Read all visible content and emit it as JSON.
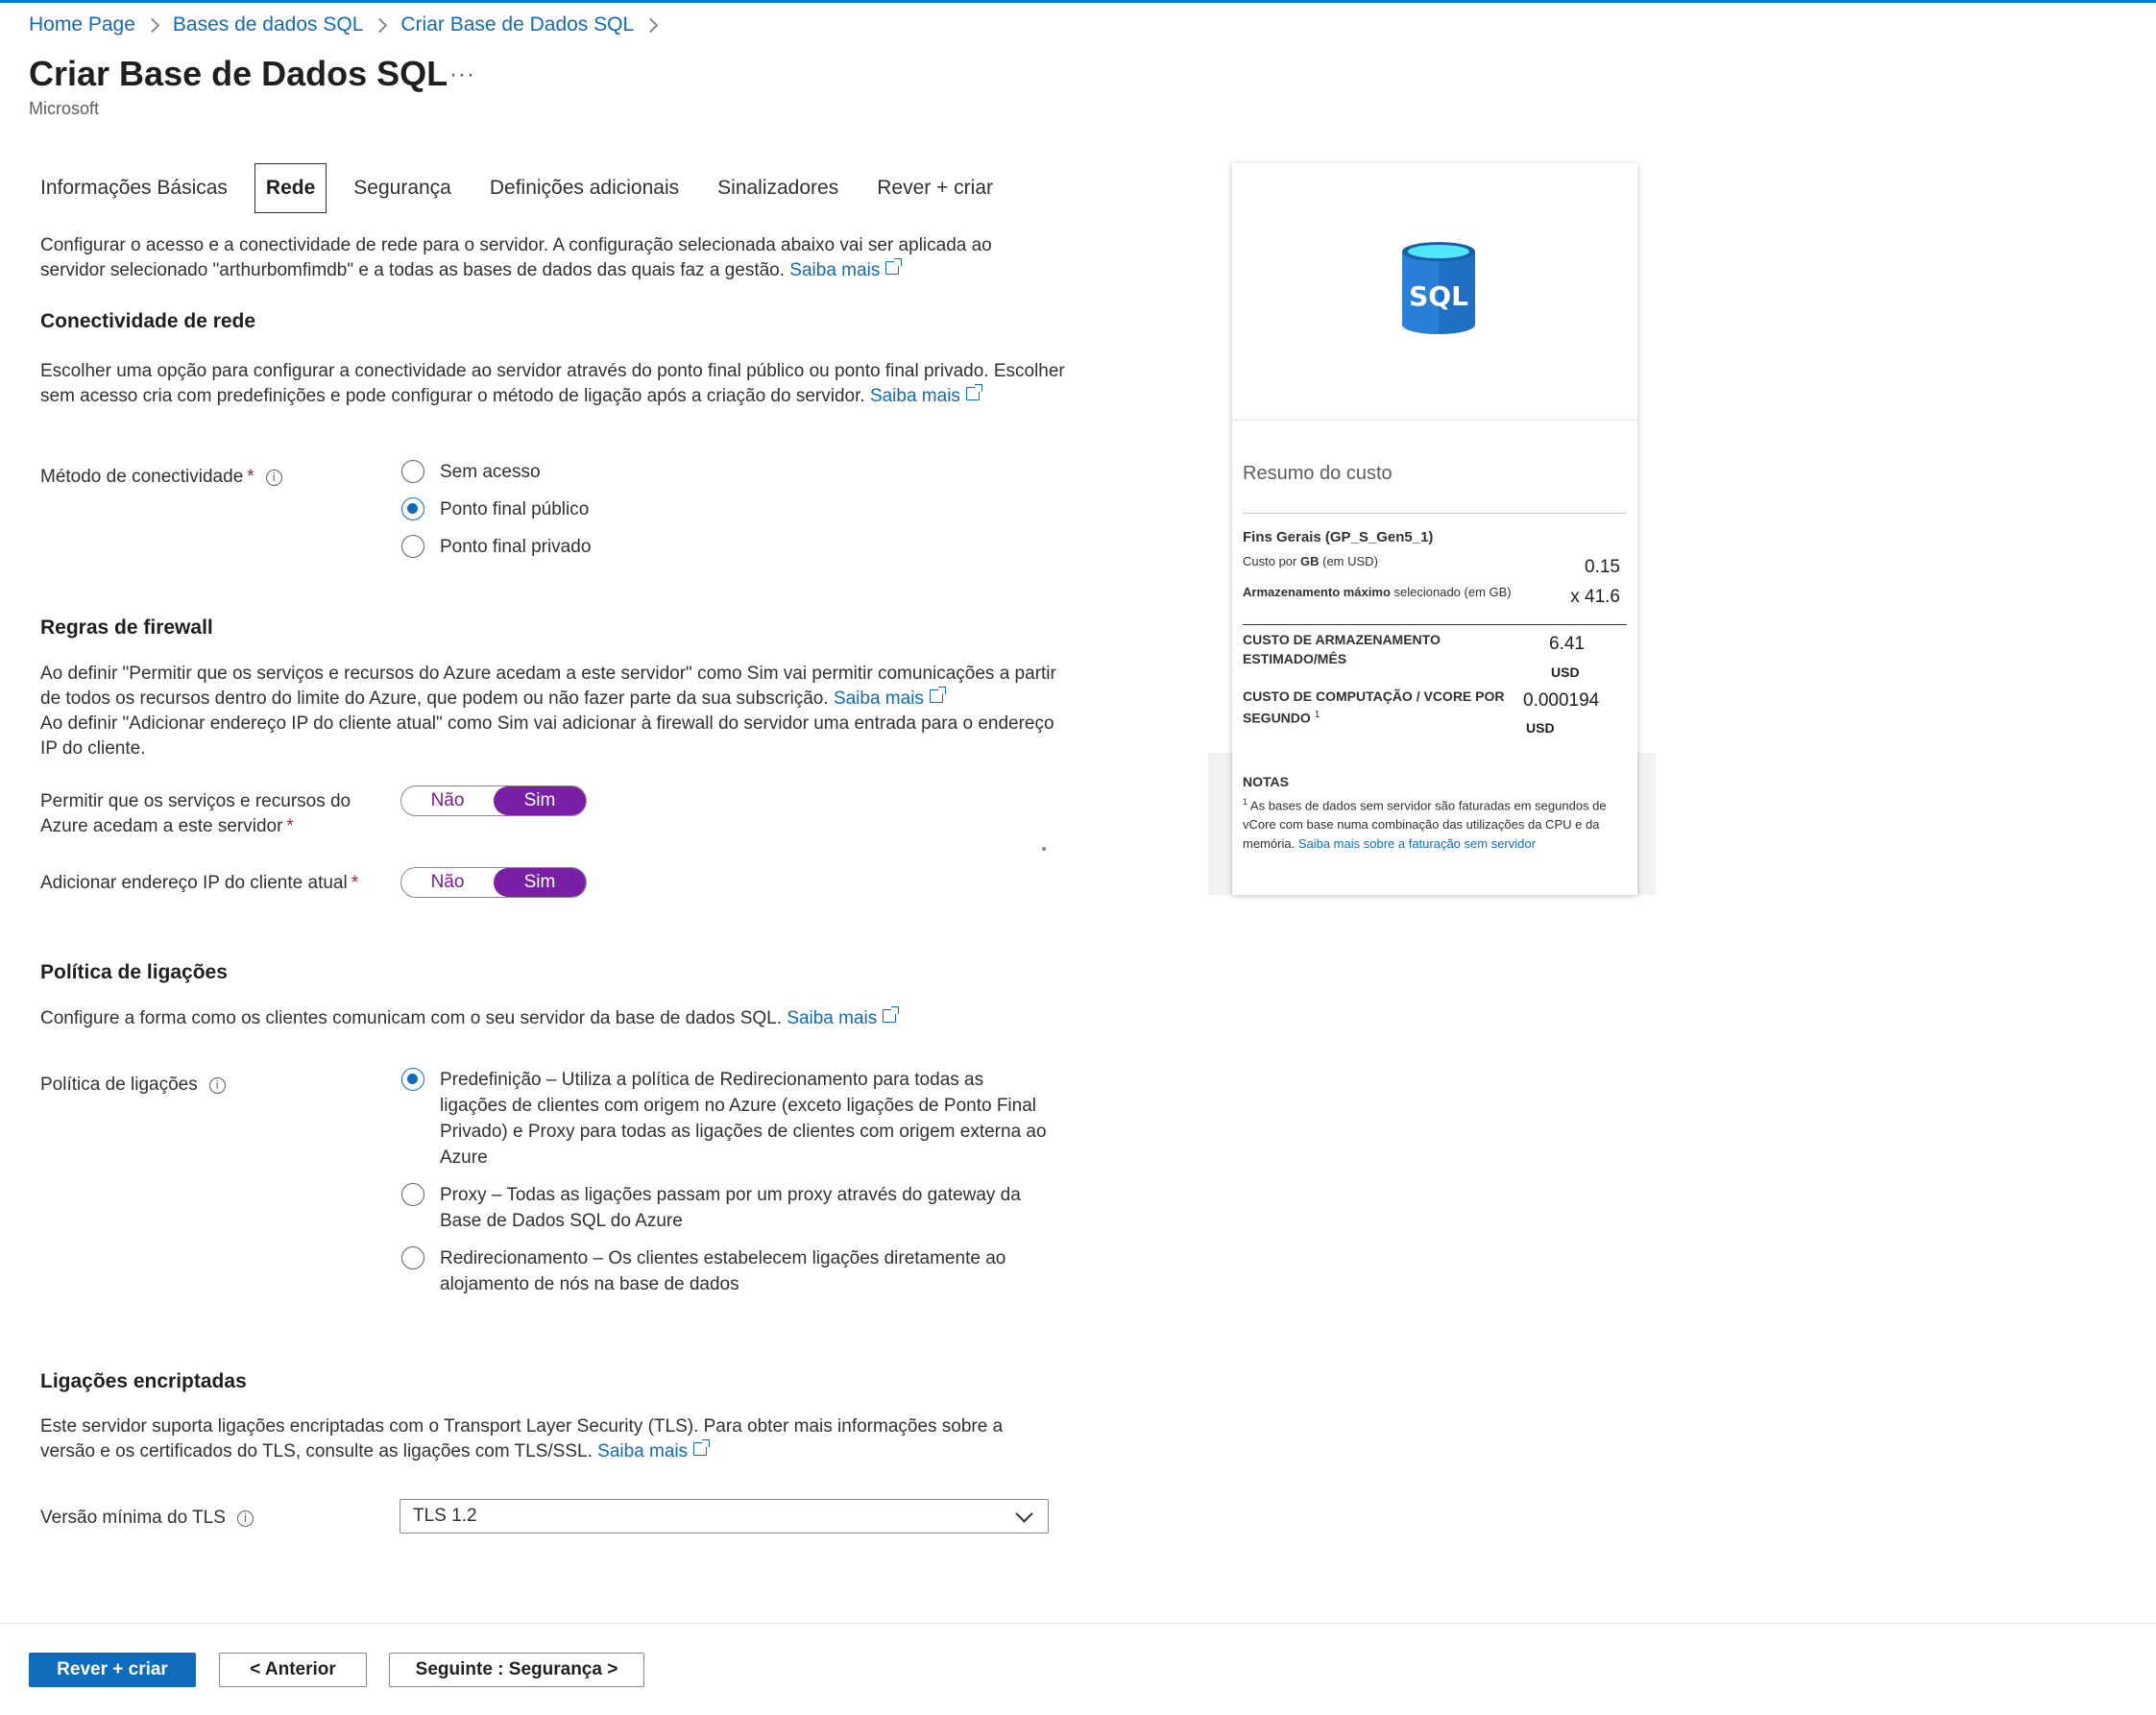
{
  "breadcrumb": [
    "Home Page",
    "Bases de dados SQL",
    "Criar Base de Dados SQL"
  ],
  "page": {
    "title": "Criar Base de Dados SQL",
    "more": "···",
    "subtitle": "Microsoft"
  },
  "tabs": [
    {
      "label": "Informações Básicas",
      "active": false
    },
    {
      "label": "Rede",
      "active": true
    },
    {
      "label": "Segurança",
      "active": false
    },
    {
      "label": "Definições adicionais",
      "active": false
    },
    {
      "label": "Sinalizadores",
      "active": false
    },
    {
      "label": "Rever + criar",
      "active": false
    }
  ],
  "intro": {
    "text": "Configurar o acesso e a conectividade de rede para o servidor. A configuração selecionada abaixo vai ser aplicada ao servidor selecionado \"arthurbomfimdb\" e a todas as bases de dados das quais faz a gestão.",
    "link": "Saiba mais"
  },
  "connectivity": {
    "title": "Conectividade de rede",
    "text": "Escolher uma opção para configurar a conectividade ao servidor através do ponto final público ou ponto final privado. Escolher sem acesso cria com predefinições e pode configurar o método de ligação após a criação do servidor.",
    "link": "Saiba mais",
    "method_label": "Método de conectividade",
    "required": "*",
    "options": [
      {
        "label": "Sem acesso",
        "selected": false
      },
      {
        "label": "Ponto final público",
        "selected": true
      },
      {
        "label": "Ponto final privado",
        "selected": false
      }
    ]
  },
  "firewall": {
    "title": "Regras de firewall",
    "text1": "Ao definir \"Permitir que os serviços e recursos do Azure acedam a este servidor\" como Sim vai permitir comunicações a partir de todos os recursos dentro do limite do Azure, que podem ou não fazer parte da sua subscrição.",
    "link": "Saiba mais",
    "text2": "Ao definir \"Adicionar endereço IP do cliente atual\" como Sim vai adicionar à firewall do servidor uma entrada para o endereço IP do cliente.",
    "allow_label": "Permitir que os serviços e recursos do Azure acedam a este servidor",
    "add_ip_label": "Adicionar endereço IP do cliente atual",
    "required": "*",
    "no": "Não",
    "yes": "Sim",
    "allow_value": "Sim",
    "add_ip_value": "Sim"
  },
  "policy": {
    "title": "Política de ligações",
    "text": "Configure a forma como os clientes comunicam com o seu servidor da base de dados SQL.",
    "link": "Saiba mais",
    "label": "Política de ligações",
    "options": [
      {
        "label": "Predefinição – Utiliza a política de Redirecionamento para todas as ligações de clientes com origem no Azure (exceto ligações de Ponto Final Privado) e Proxy para todas as ligações de clientes com origem externa ao Azure",
        "selected": true
      },
      {
        "label": "Proxy – Todas as ligações passam por um proxy através do gateway da Base de Dados SQL do Azure",
        "selected": false
      },
      {
        "label": "Redirecionamento – Os clientes estabelecem ligações diretamente ao alojamento de nós na base de dados",
        "selected": false
      }
    ]
  },
  "tls": {
    "title": "Ligações encriptadas",
    "text": "Este servidor suporta ligações encriptadas com o Transport Layer Security (TLS). Para obter mais informações sobre a versão e os certificados do TLS, consulte as ligações com TLS/SSL.",
    "link": "Saiba mais",
    "label": "Versão mínima do TLS",
    "value": "TLS 1.2"
  },
  "cost": {
    "icon_text": "SQL",
    "title": "Resumo do custo",
    "tier": "Fins Gerais (GP_S_Gen5_1)",
    "cost_per_gb_pre": "Custo por",
    "cost_per_gb_bold": "GB",
    "cost_per_gb_post": "(em USD)",
    "cost_per_gb_value": "0.15",
    "max_storage_bold": "Armazenamento máximo",
    "max_storage_post": "selecionado (em GB)",
    "max_storage_value": "x 41.6",
    "storage_cost_label": "CUSTO DE ARMAZENAMENTO ESTIMADO/MÊS",
    "storage_cost_value": "6.41",
    "storage_cost_unit": "USD",
    "compute_cost_label": "CUSTO DE COMPUTAÇÃO / VCORE POR SEGUNDO",
    "compute_sup": "1",
    "compute_cost_value": "0.000194",
    "compute_cost_unit": "USD",
    "notes_title": "NOTAS",
    "notes_sup": "1",
    "notes_text": "As bases de dados sem servidor são faturadas em segundos de vCore com base numa combinação das utilizações da CPU e da memória.",
    "notes_link": "Saiba mais sobre a faturação sem servidor"
  },
  "footer": {
    "review": "Rever + criar",
    "previous": "< Anterior",
    "next": "Seguinte : Segurança >"
  },
  "colors": {
    "accent": "#0f6cbd",
    "toggle": "#7a1ea6",
    "required": "#a4262c"
  }
}
